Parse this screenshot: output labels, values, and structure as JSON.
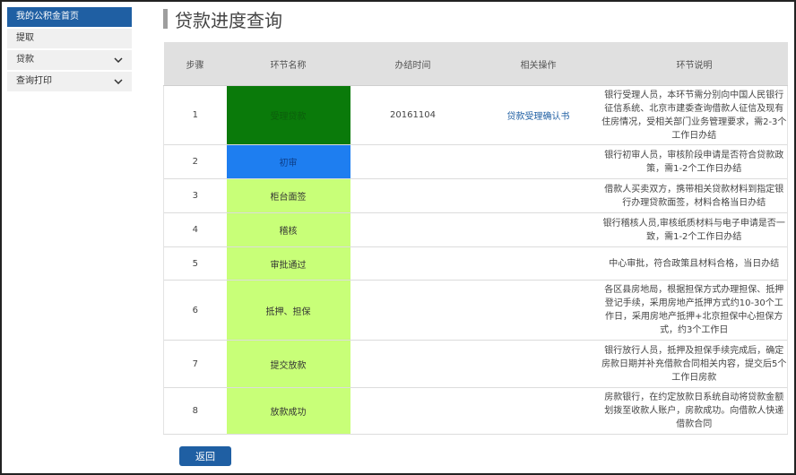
{
  "sidebar": {
    "items": [
      {
        "label": "我的公积金首页",
        "active": true,
        "chevron": false
      },
      {
        "label": "提取",
        "active": false,
        "chevron": false
      },
      {
        "label": "贷款",
        "active": false,
        "chevron": true
      },
      {
        "label": "查询打印",
        "active": false,
        "chevron": true
      }
    ]
  },
  "page": {
    "title": "贷款进度查询"
  },
  "table": {
    "headers": [
      "步骤",
      "环节名称",
      "办结时间",
      "相关操作",
      "环节说明"
    ],
    "rows": [
      {
        "step": "1",
        "name": "受理贷款",
        "status": "done",
        "date": "20161104",
        "action": "贷款受理确认书",
        "desc": "银行受理人员，本环节需分别向中国人民银行征信系统、北京市建委查询借款人征信及现有住房情况，受相关部门业务管理要求，需2-3个工作日办结"
      },
      {
        "step": "2",
        "name": "初审",
        "status": "current",
        "date": "",
        "action": "",
        "desc": "银行初审人员，审核阶段申请是否符合贷款政策，需1-2个工作日办结"
      },
      {
        "step": "3",
        "name": "柜台面签",
        "status": "pending",
        "date": "",
        "action": "",
        "desc": "借款人买卖双方，携带相关贷款材料到指定银行办理贷款面签，材料合格当日办结"
      },
      {
        "step": "4",
        "name": "稽核",
        "status": "pending",
        "date": "",
        "action": "",
        "desc": "银行稽核人员,审核纸质材料与电子申请是否一致，需1-2个工作日办结"
      },
      {
        "step": "5",
        "name": "审批通过",
        "status": "pending",
        "date": "",
        "action": "",
        "desc": "中心审批，符合政策且材料合格，当日办结"
      },
      {
        "step": "6",
        "name": "抵押、担保",
        "status": "pending",
        "date": "",
        "action": "",
        "desc": "各区县房地局，根据担保方式办理担保、抵押登记手续，采用房地产抵押方式约10-30个工作日，采用房地产抵押+北京担保中心担保方式，约3个工作日"
      },
      {
        "step": "7",
        "name": "提交放款",
        "status": "pending",
        "date": "",
        "action": "",
        "desc": "银行放行人员，抵押及担保手续完成后，确定房款日期并补充借款合同相关内容，提交后5个工作日房款"
      },
      {
        "step": "8",
        "name": "放款成功",
        "status": "pending",
        "date": "",
        "action": "",
        "desc": "房款银行，在约定放款日系统自动将贷款金额划拨至收款人账户，房款成功。向借款人快递借款合同"
      }
    ]
  },
  "back_button": {
    "label": "返回"
  },
  "colors": {
    "done": "#0a7a0a",
    "current": "#1e7ef0",
    "pending": "#c8ff78",
    "accent": "#1f5fa3"
  }
}
